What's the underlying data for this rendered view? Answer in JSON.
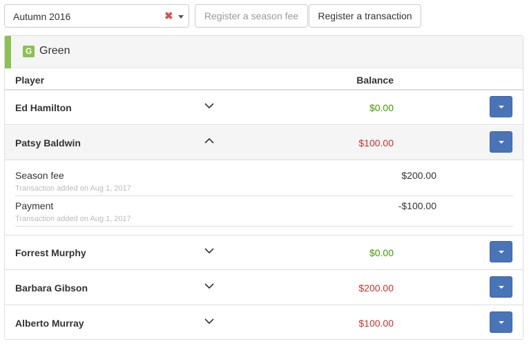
{
  "toolbar": {
    "season_value": "Autumn 2016",
    "clear_symbol": "✖",
    "register_season_fee": "Register a season fee",
    "register_transaction": "Register a transaction"
  },
  "team": {
    "badge": "G",
    "name": "Green",
    "color": "#8cc152"
  },
  "columns": {
    "player": "Player",
    "balance": "Balance"
  },
  "colors": {
    "positive": "#5cb85c",
    "zero": "#3c9a00",
    "negative": "#c9302c",
    "primary": "#4a74b8"
  },
  "players": [
    {
      "name": "Ed Hamilton",
      "balance": "$0.00",
      "status": "zero",
      "expanded": false
    },
    {
      "name": "Patsy Baldwin",
      "balance": "$100.00",
      "status": "negative",
      "expanded": true
    },
    {
      "name": "Forrest Murphy",
      "balance": "$0.00",
      "status": "zero",
      "expanded": false
    },
    {
      "name": "Barbara Gibson",
      "balance": "$200.00",
      "status": "negative",
      "expanded": false
    },
    {
      "name": "Alberto Murray",
      "balance": "$100.00",
      "status": "negative",
      "expanded": false
    }
  ],
  "transactions": [
    {
      "label": "Season fee",
      "meta": "Transaction added on Aug 1, 2017",
      "amount": "$200.00"
    },
    {
      "label": "Payment",
      "meta": "Transaction added on Aug 1, 2017",
      "amount": "-$100.00"
    }
  ]
}
